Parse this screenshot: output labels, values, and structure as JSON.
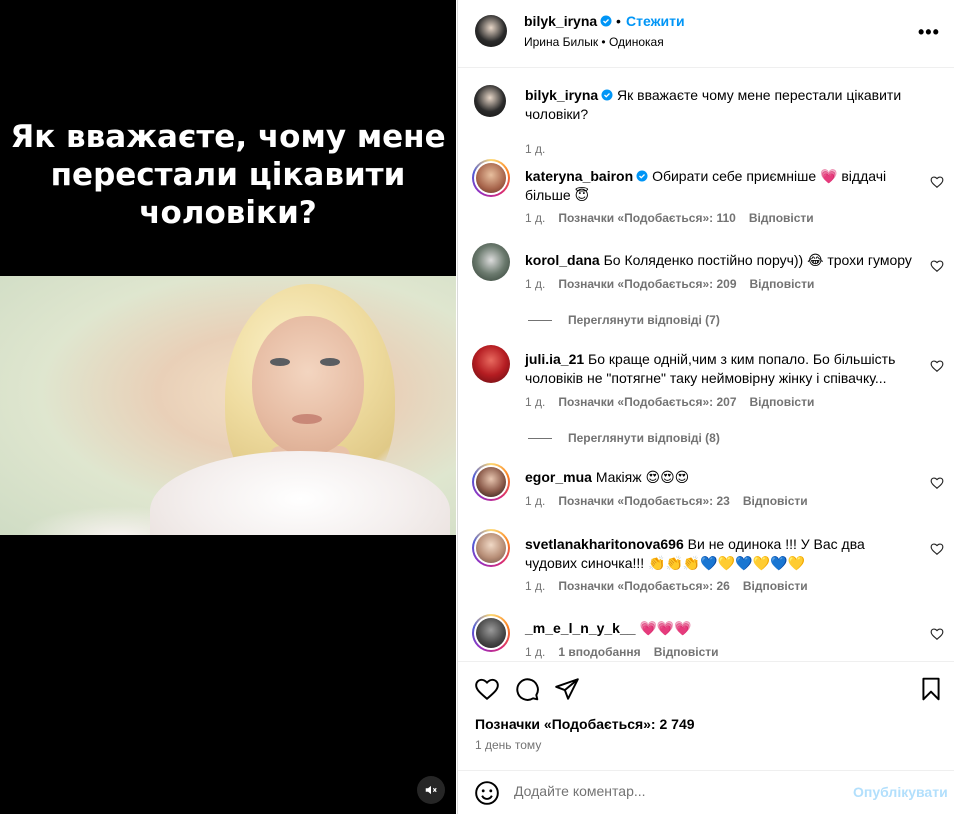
{
  "media": {
    "caption_lines": [
      "Як вважаєте, чому мене",
      "перестали цікавити",
      "чоловіки?"
    ]
  },
  "header": {
    "username": "bilyk_iryna",
    "separator": "•",
    "follow_label": "Стежити",
    "subtitle": "Ирина Билык • Одинокая"
  },
  "post_caption": {
    "username": "bilyk_iryna",
    "text": "Як вважаєте чому мене перестали цікавити чоловіки?",
    "time": "1 д."
  },
  "comments": [
    {
      "username": "kateryna_bairon",
      "text": "Обирати себе приємніше 💗 віддачі більше 😇",
      "time": "1 д.",
      "likes": "Позначки «Подобається»: 110",
      "reply": "Відповісти"
    },
    {
      "username": "korol_dana",
      "text": "Бо Коляденко постійно поруч)) 😂 трохи гумору",
      "time": "1 д.",
      "likes": "Позначки «Подобається»: 209",
      "reply": "Відповісти",
      "view_replies": "Переглянути відповіді (7)"
    },
    {
      "username": "juli.ia_21",
      "text": "Бо краще одній,чим з ким попало. Бо більшість чоловіків не \"потягне\" таку неймовірну жінку і співачку...",
      "time": "1 д.",
      "likes": "Позначки «Подобається»: 207",
      "reply": "Відповісти",
      "view_replies": "Переглянути відповіді (8)"
    },
    {
      "username": "egor_mua",
      "text": "Макіяж 😍😍😍",
      "time": "1 д.",
      "likes": "Позначки «Подобається»: 23",
      "reply": "Відповісти"
    },
    {
      "username": "svetlanakharitonova696",
      "text": "Ви не одинока !!! У Вас два чудових синочка!!! 👏👏👏💙💛💙💛💙💛",
      "time": "1 д.",
      "likes": "Позначки «Подобається»: 26",
      "reply": "Відповісти"
    },
    {
      "username": "_m_e_l_n_y_k__",
      "text": "💗💗💗",
      "time": "1 д.",
      "likes": "1 вподобання",
      "reply": "Відповісти"
    }
  ],
  "footer": {
    "likes": "Позначки «Подобається»: 2 749",
    "time": "1 день тому",
    "comment_placeholder": "Додайте коментар...",
    "post_label": "Опублікувати"
  },
  "colors": {
    "accent": "#0095f6",
    "muted": "#737373",
    "post_disabled": "#b2dffc",
    "verified": "#0095f6"
  },
  "icons": [
    "verified-icon",
    "more-icon",
    "heart-icon",
    "comment-icon",
    "share-icon",
    "bookmark-icon",
    "emoji-icon",
    "mute-icon"
  ]
}
